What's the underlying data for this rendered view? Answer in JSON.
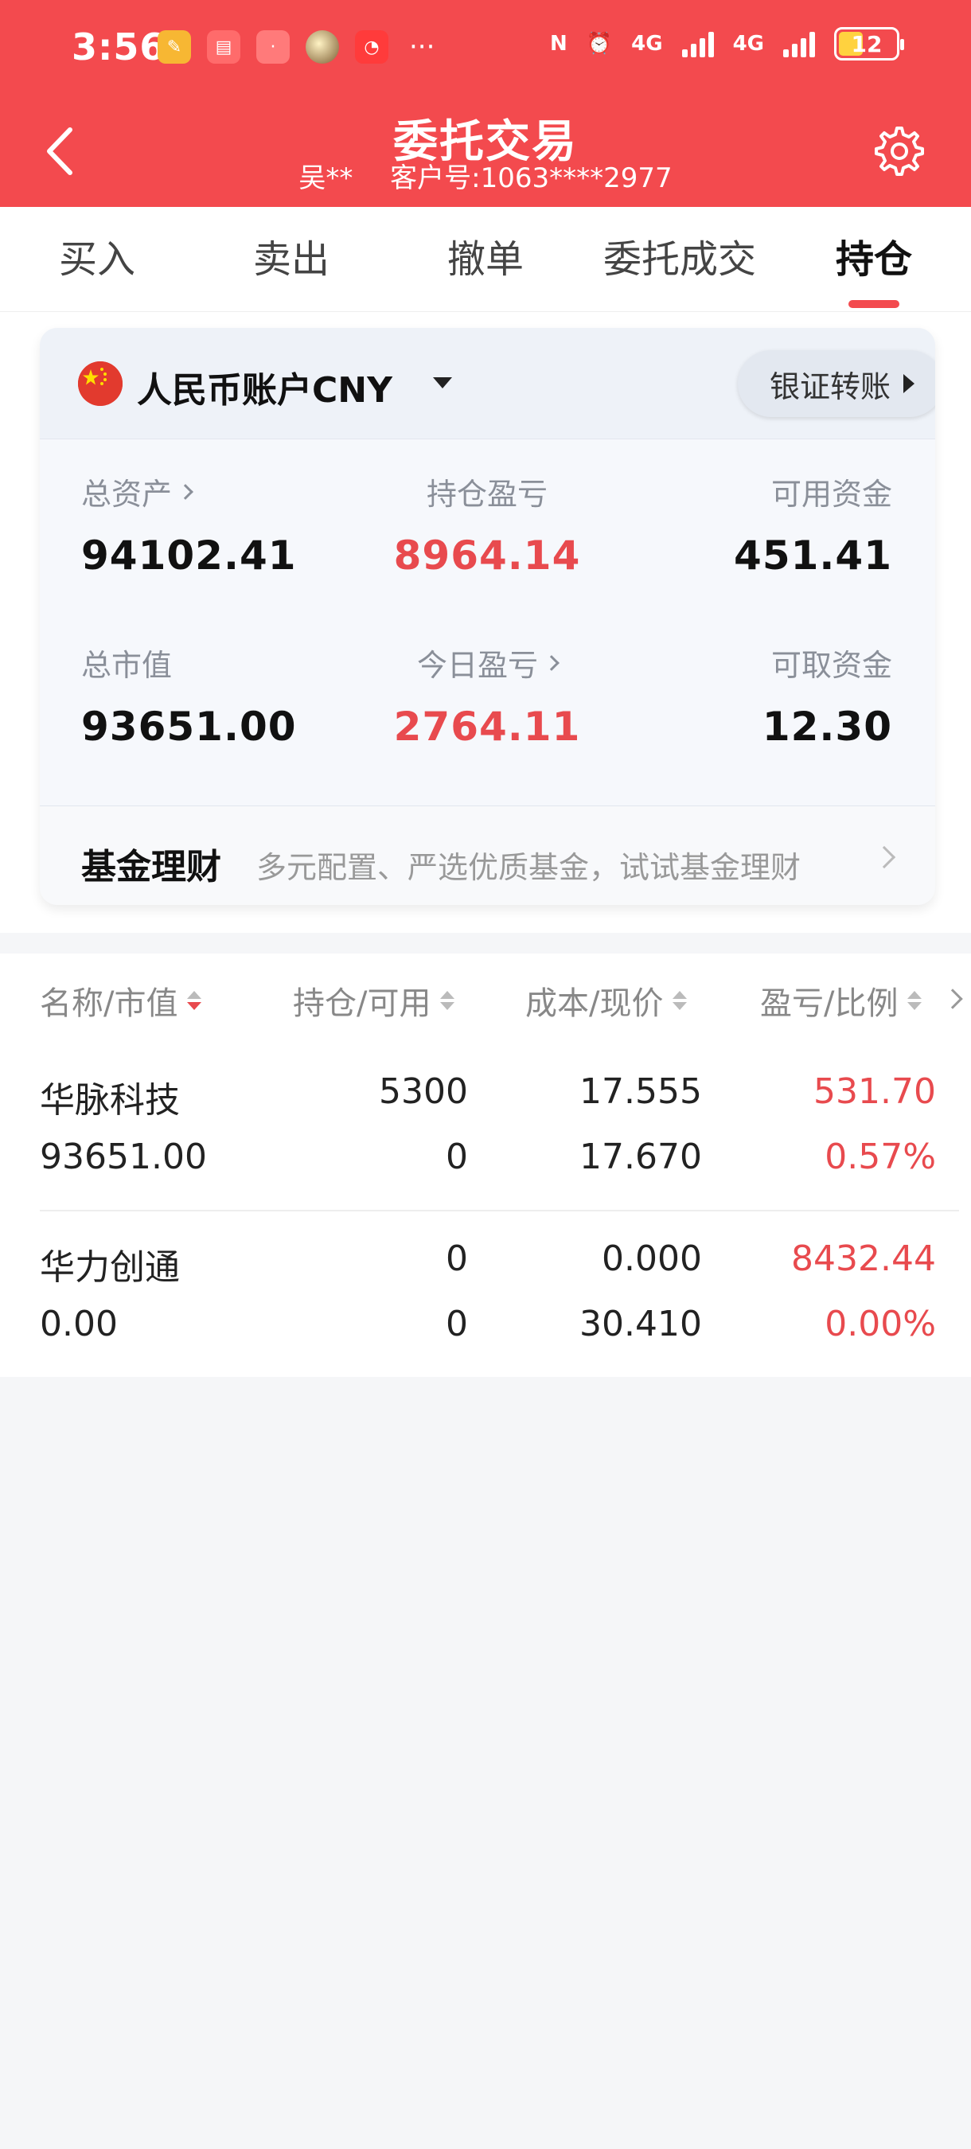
{
  "status_bar": {
    "time": "3:56",
    "network_1": "4G",
    "network_2": "4G",
    "battery": "12",
    "more": "···"
  },
  "header": {
    "title": "委托交易",
    "user_name": "吴**",
    "customer_id": "客户号:1063****2977",
    "background_color": "#f34a4e"
  },
  "tabs": [
    {
      "label": "买入",
      "active": false
    },
    {
      "label": "卖出",
      "active": false
    },
    {
      "label": "撤单",
      "active": false
    },
    {
      "label": "委托成交",
      "active": false
    },
    {
      "label": "持仓",
      "active": true
    }
  ],
  "account": {
    "name": "人民币账户CNY",
    "transfer_label": "银证转账",
    "metrics": {
      "total_assets": {
        "label": "总资产",
        "value": "94102.41"
      },
      "position_pnl": {
        "label": "持仓盈亏",
        "value": "8964.14"
      },
      "available_funds": {
        "label": "可用资金",
        "value": "451.41"
      },
      "market_value": {
        "label": "总市值",
        "value": "93651.00"
      },
      "today_pnl": {
        "label": "今日盈亏",
        "value": "2764.11"
      },
      "withdrawable_funds": {
        "label": "可取资金",
        "value": "12.30"
      }
    },
    "fund": {
      "title": "基金理财",
      "desc": "多元配置、严选优质基金，试试基金理财"
    }
  },
  "holdings": {
    "headers": {
      "name": "名称/市值",
      "position": "持仓/可用",
      "cost": "成本/现价",
      "pnl": "盈亏/比例"
    },
    "rows": [
      {
        "name": "华脉科技",
        "market_value": "93651.00",
        "position": "5300",
        "available": "0",
        "cost": "17.555",
        "price": "17.670",
        "pnl": "531.70",
        "ratio": "0.57%"
      },
      {
        "name": "华力创通",
        "market_value": "0.00",
        "position": "0",
        "available": "0",
        "cost": "0.000",
        "price": "30.410",
        "pnl": "8432.44",
        "ratio": "0.00%"
      }
    ]
  },
  "colors": {
    "accent_red": "#f34a4e",
    "gain_red": "#e84a4e"
  }
}
